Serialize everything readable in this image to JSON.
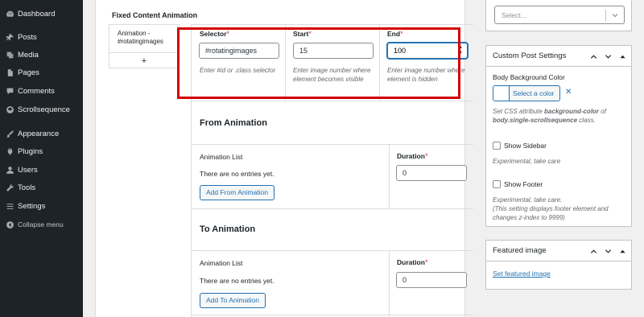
{
  "sidebar": {
    "items": [
      {
        "label": "Dashboard",
        "icon": "dashboard-icon"
      },
      {
        "label": "Posts",
        "icon": "pin-icon"
      },
      {
        "label": "Media",
        "icon": "media-icon"
      },
      {
        "label": "Pages",
        "icon": "page-icon"
      },
      {
        "label": "Comments",
        "icon": "comment-icon"
      },
      {
        "label": "Scrollsequence",
        "icon": "scroll-icon"
      },
      {
        "label": "Appearance",
        "icon": "brush-icon"
      },
      {
        "label": "Plugins",
        "icon": "plugin-icon"
      },
      {
        "label": "Users",
        "icon": "user-icon"
      },
      {
        "label": "Tools",
        "icon": "wrench-icon"
      },
      {
        "label": "Settings",
        "icon": "settings-icon"
      },
      {
        "label": "Collapse menu",
        "icon": "collapse-icon"
      }
    ]
  },
  "main": {
    "section_title": "Fixed Content Animation",
    "tab": {
      "label": "Animation - #rotatingimages",
      "add": "+"
    },
    "fields": {
      "selector": {
        "label": "Selector",
        "req": "*",
        "value": "#rotatingimages",
        "hint": "Enter #id or .class selector"
      },
      "start": {
        "label": "Start",
        "req": "*",
        "value": "15",
        "hint": "Enter image number where element becomes visible"
      },
      "end": {
        "label": "End",
        "req": "*",
        "value": "100",
        "hint": "Enter image number where element is hidden"
      }
    },
    "from_animation": {
      "title": "From Animation",
      "list_label": "Animation List",
      "empty": "There are no entries yet.",
      "button": "Add From Animation",
      "duration_label": "Duration",
      "duration_req": "*",
      "duration_value": "0"
    },
    "to_animation": {
      "title": "To Animation",
      "list_label": "Animation List",
      "empty": "There are no entries yet.",
      "button": "Add To Animation",
      "duration_label": "Duration",
      "duration_req": "*",
      "duration_value": "0"
    }
  },
  "right": {
    "select": {
      "placeholder": "Select..."
    },
    "custom_settings": {
      "title": "Custom Post Settings",
      "bg_label": "Body Background Color",
      "select_color": "Select a color",
      "clear": "✕",
      "bg_hint_1": "Set CSS attribute ",
      "bg_hint_bold_1": "background-color",
      "bg_hint_2": " of ",
      "bg_hint_bold_2": "body.single-scrollsequence",
      "bg_hint_3": " class.",
      "show_sidebar": "Show Sidebar",
      "sidebar_hint": "Experimental, take care",
      "show_footer": "Show Footer",
      "footer_hint_1": "Experimental, take care.",
      "footer_hint_2": "(This setting displays footer element and changes z-index to 9999)"
    },
    "featured": {
      "title": "Featured image",
      "link": "Set featured image"
    }
  },
  "colors": {
    "sidebar_bg": "#1d2327",
    "accent": "#2271b1",
    "highlight_border": "#d40000",
    "required": "#d63638"
  }
}
